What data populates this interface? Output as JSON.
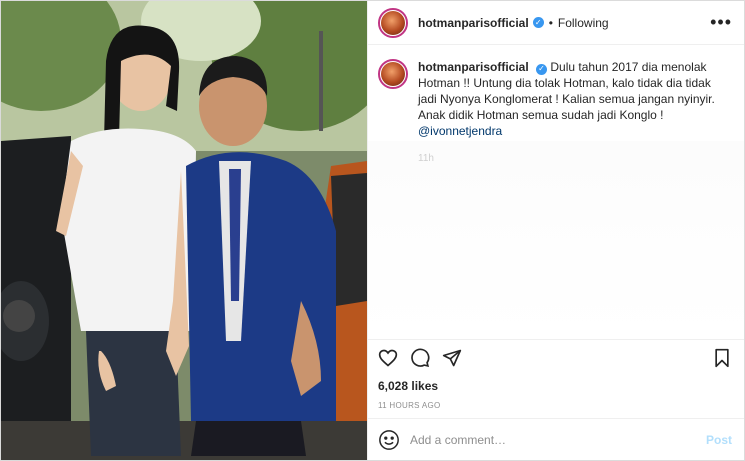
{
  "post": {
    "username": "hotmanparisofficial",
    "verified_symbol": "✓",
    "separator": "•",
    "follow_status": "Following",
    "more_symbol": "•••",
    "caption": {
      "username": "hotmanparisofficial",
      "text": "Dulu tahun 2017 dia menolak Hotman !! Untung dia tolak Hotman, kalo tidak dia tidak jadi Nyonya Konglomerat ! Kalian semua jangan nyinyir. Anak didik Hotman semua sudah jadi Konglo !",
      "mention": "@ivonnetjendra",
      "time": "11h"
    },
    "likes": "6,028 likes",
    "posted_ago": "11 HOURS AGO",
    "comment_placeholder": "Add a comment…",
    "post_button": "Post",
    "icons": [
      "heart-icon",
      "comment-icon",
      "share-icon",
      "bookmark-icon",
      "emoji-icon",
      "more-options-icon",
      "verified-badge-icon"
    ],
    "colors": {
      "link": "#00376b",
      "verified": "#3897f0",
      "post_disabled": "#b2dffc",
      "muted": "#8e8e8e"
    }
  }
}
